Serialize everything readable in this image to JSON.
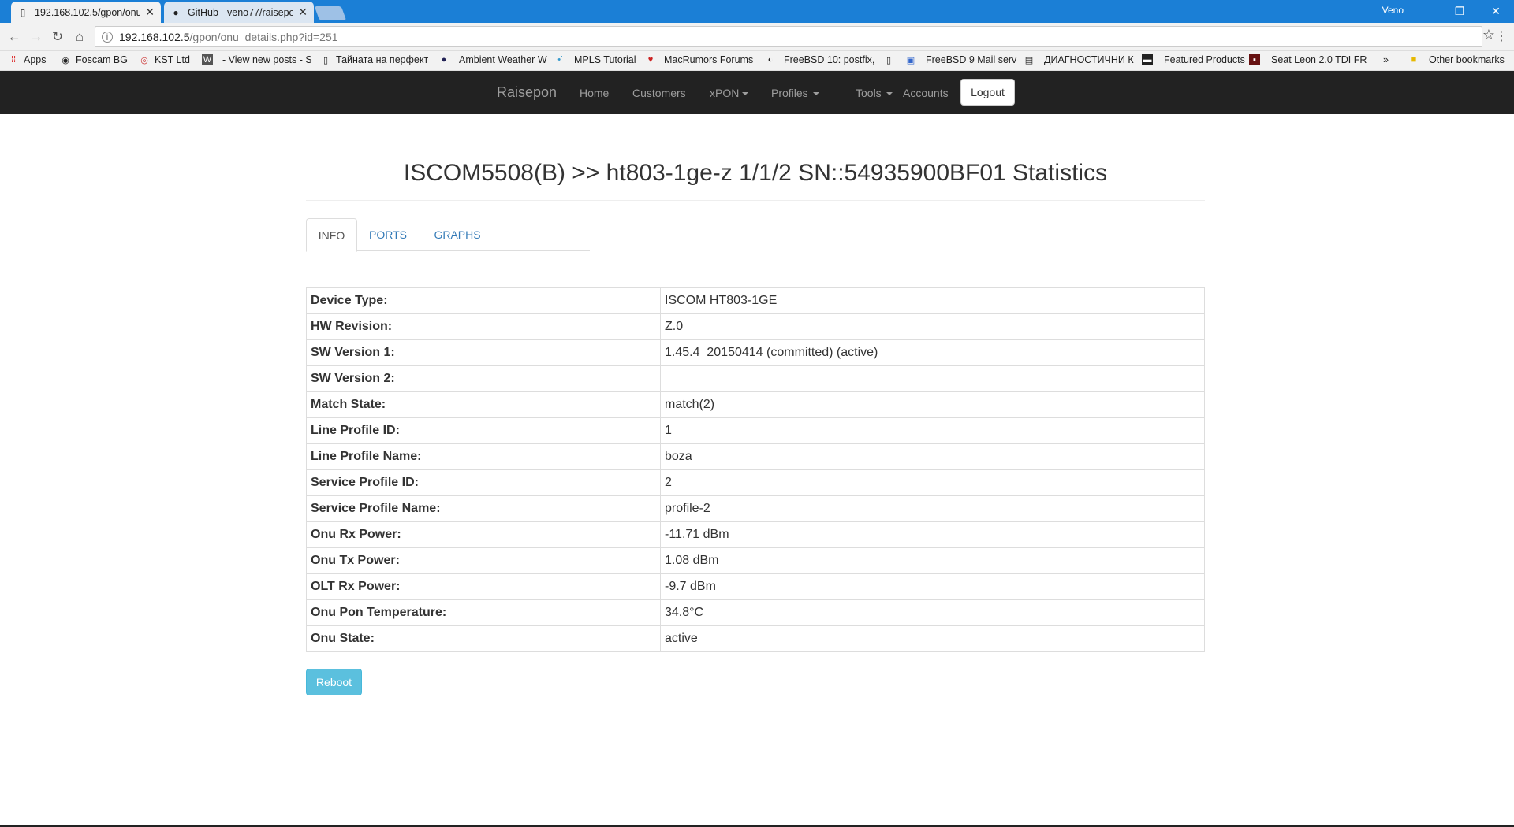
{
  "browser": {
    "tabs": [
      {
        "title": "192.168.102.5/gpon/onu_",
        "active": true
      },
      {
        "title": "GitHub - veno77/raisepo",
        "active": false
      }
    ],
    "user": "Veno",
    "url_host": "192.168.102.5",
    "url_path": "/gpon/onu_details.php?id=251",
    "bookmarks": [
      {
        "label": "Apps",
        "icon": "apps-grid-icon"
      },
      {
        "label": "Foscam BG",
        "icon": "foscam-icon"
      },
      {
        "label": "KST Ltd",
        "icon": "kst-icon"
      },
      {
        "label": "- View new posts - S",
        "icon": "w-icon"
      },
      {
        "label": "Тайната на перфект",
        "icon": "page-icon"
      },
      {
        "label": "Ambient Weather W",
        "icon": "globe-icon"
      },
      {
        "label": "MPLS Tutorial",
        "icon": "mpls-icon"
      },
      {
        "label": "MacRumors Forums",
        "icon": "apple-icon"
      },
      {
        "label": "FreeBSD 10: postfix,",
        "icon": "freebsd-icon"
      },
      {
        "label": "",
        "icon": "page-icon"
      },
      {
        "label": "FreeBSD 9 Mail serv",
        "icon": "window-icon"
      },
      {
        "label": "ДИАГНОСТИЧНИ К",
        "icon": "clipboard-icon"
      },
      {
        "label": "Featured Products",
        "icon": "product-icon"
      },
      {
        "label": "Seat Leon 2.0 TDI FR",
        "icon": "seat-icon"
      }
    ],
    "overflow": "»",
    "other_bookmarks": "Other bookmarks"
  },
  "navbar": {
    "brand": "Raisepon",
    "items": [
      "Home",
      "Customers",
      "xPON",
      "Profiles",
      "Tools",
      "Accounts"
    ],
    "logout": "Logout"
  },
  "page": {
    "title": "ISCOM5508(B) >> ht803-1ge-z 1/1/2 SN::54935900BF01 Statistics",
    "tabs": [
      "INFO",
      "PORTS",
      "GRAPHS"
    ],
    "details": [
      {
        "label": "Device Type:",
        "value": "ISCOM HT803-1GE"
      },
      {
        "label": "HW Revision:",
        "value": "Z.0"
      },
      {
        "label": "SW Version 1:",
        "value": "1.45.4_20150414 (committed) (active)"
      },
      {
        "label": "SW Version 2:",
        "value": ""
      },
      {
        "label": "Match State:",
        "value": "match(2)"
      },
      {
        "label": "Line Profile ID:",
        "value": "1"
      },
      {
        "label": "Line Profile Name:",
        "value": "boza"
      },
      {
        "label": "Service Profile ID:",
        "value": "2"
      },
      {
        "label": "Service Profile Name:",
        "value": "profile-2"
      },
      {
        "label": "Onu Rx Power:",
        "value": "-11.71 dBm"
      },
      {
        "label": "Onu Tx Power:",
        "value": "1.08 dBm"
      },
      {
        "label": "OLT Rx Power:",
        "value": "-9.7 dBm"
      },
      {
        "label": "Onu Pon Temperature:",
        "value": "34.8°C"
      },
      {
        "label": "Onu State:",
        "value": "active"
      }
    ],
    "reboot": "Reboot"
  },
  "colors": {
    "titlebar": "#1b7fd6",
    "navbar": "#222222",
    "link": "#337ab7",
    "reboot": "#5bc0de"
  }
}
